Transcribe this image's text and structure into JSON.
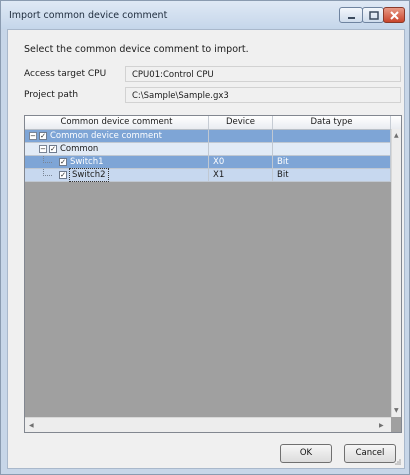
{
  "window": {
    "title": "Import common device comment"
  },
  "instruction": "Select the common device comment to import.",
  "fields": {
    "access_cpu_label": "Access target CPU",
    "access_cpu_value": "CPU01:Control CPU",
    "project_path_label": "Project path",
    "project_path_value": "C:\\Sample\\Sample.gx3"
  },
  "grid": {
    "columns": [
      "Common device comment",
      "Device",
      "Data type"
    ],
    "rows": [
      {
        "label": "Common device comment",
        "device": "",
        "data_type": "",
        "level": 0,
        "expander": "−",
        "checked": "✓",
        "selected": true
      },
      {
        "label": "Common",
        "device": "",
        "data_type": "",
        "level": 1,
        "expander": "−",
        "checked": "✓",
        "selected": false
      },
      {
        "label": "Switch1",
        "device": "X0",
        "data_type": "Bit",
        "level": 2,
        "expander": "",
        "checked": "✓",
        "selected": true
      },
      {
        "label": "Switch2",
        "device": "X1",
        "data_type": "Bit",
        "level": 2,
        "expander": "",
        "checked": "✓",
        "selected": false
      }
    ]
  },
  "buttons": {
    "ok": "OK",
    "cancel": "Cancel"
  },
  "colors": {
    "selected_row": "#7ea5d6",
    "current_row": "#c7d8ef",
    "normal_row": "#e2ebf6",
    "grid_empty": "#a0a0a0"
  }
}
